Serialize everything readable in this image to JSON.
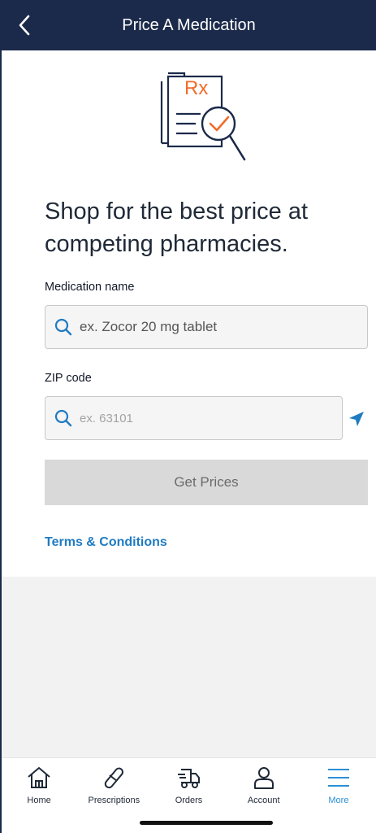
{
  "header": {
    "title": "Price A Medication"
  },
  "hero": {
    "rx_text": "Rx"
  },
  "headline": "Shop for the best price at competing pharmacies.",
  "medication": {
    "label": "Medication name",
    "placeholder": "ex. Zocor 20 mg tablet",
    "value": ""
  },
  "zip": {
    "label": "ZIP code",
    "placeholder": "ex. 63101",
    "value": ""
  },
  "get_prices_label": "Get Prices",
  "terms_label": "Terms & Conditions",
  "colors": {
    "navy": "#1b2a4a",
    "accent_blue": "#1f7bc1",
    "rx_orange": "#f26b2a"
  },
  "tabs": [
    {
      "label": "Home",
      "icon": "home-icon",
      "active": false
    },
    {
      "label": "Prescriptions",
      "icon": "pill-icon",
      "active": false
    },
    {
      "label": "Orders",
      "icon": "truck-icon",
      "active": false
    },
    {
      "label": "Account",
      "icon": "person-icon",
      "active": false
    },
    {
      "label": "More",
      "icon": "menu-icon",
      "active": true
    }
  ]
}
